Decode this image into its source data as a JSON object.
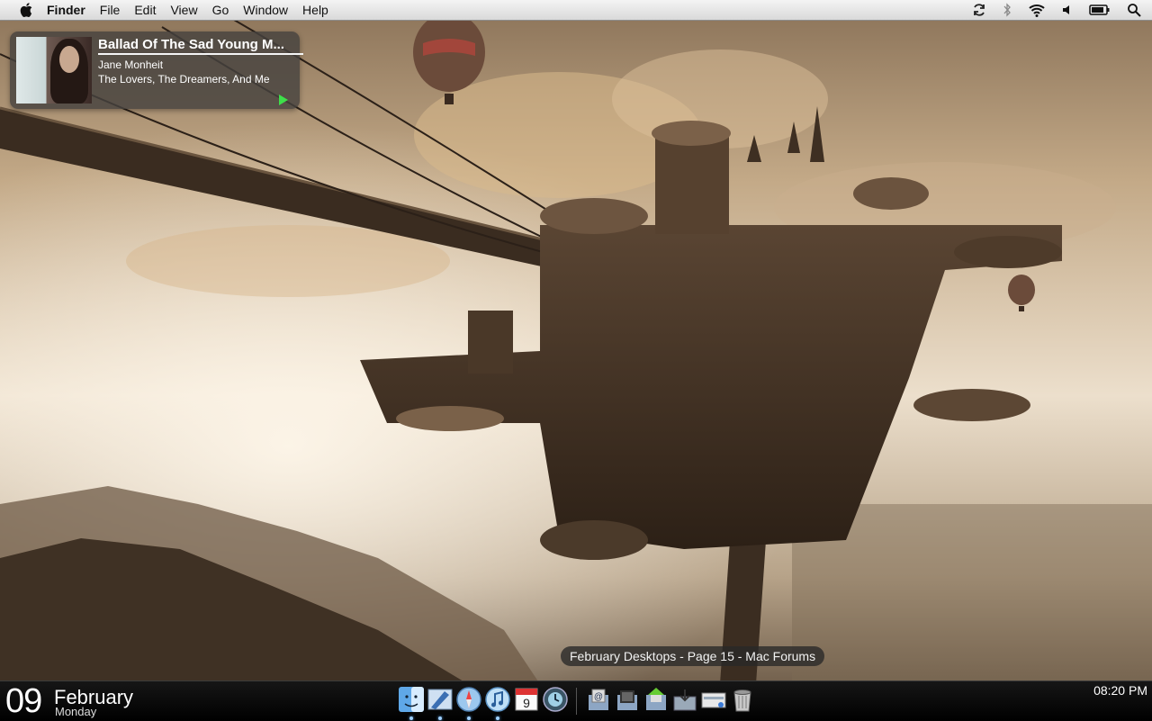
{
  "menubar": {
    "app_name": "Finder",
    "menus": [
      "File",
      "Edit",
      "View",
      "Go",
      "Window",
      "Help"
    ],
    "status_icons": [
      "sync-icon",
      "bluetooth-icon",
      "wifi-icon",
      "volume-icon",
      "battery-icon",
      "spotlight-icon"
    ]
  },
  "now_playing": {
    "title": "Ballad Of The Sad Young M...",
    "artist": "Jane Monheit",
    "album": "The Lovers, The Dreamers, And Me",
    "play_color": "#3ee04a"
  },
  "window_title": "February Desktops - Page 15 - Mac Forums",
  "date_widget": {
    "day": "09",
    "month": "February",
    "weekday": "Monday"
  },
  "clock": "08:20 PM",
  "dock": {
    "apps": [
      {
        "name": "finder-icon",
        "running": true
      },
      {
        "name": "mail-icon",
        "running": true
      },
      {
        "name": "safari-icon",
        "running": true
      },
      {
        "name": "itunes-icon",
        "running": true
      },
      {
        "name": "ical-icon",
        "running": false,
        "badge": "9"
      },
      {
        "name": "time-machine-icon",
        "running": false
      }
    ],
    "stacks": [
      "applications-stack-icon",
      "documents-stack-icon",
      "folder-stack-icon",
      "downloads-stack-icon",
      "network-stack-icon",
      "trash-icon"
    ]
  },
  "colors": {
    "menubar_bg": "#e4e4e4",
    "sky": "#c9b497",
    "accent_running_dot": "#9fd0ff"
  }
}
